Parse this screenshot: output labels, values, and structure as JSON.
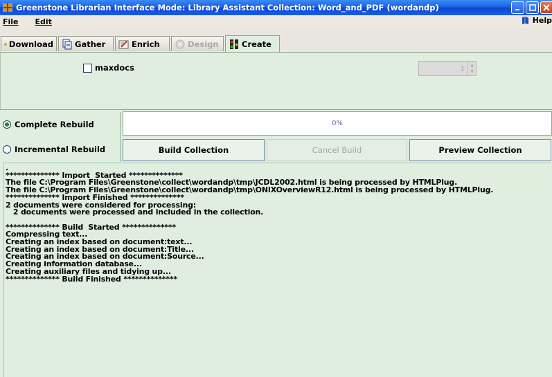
{
  "window": {
    "title": "Greenstone Librarian Interface  Mode: Library Assistant  Collection: Word_and_PDF (wordandp)"
  },
  "menu": {
    "file": "File",
    "edit": "Edit",
    "help": "Help"
  },
  "tabs": [
    {
      "label": "Download",
      "icon": "download-icon",
      "enabled": true
    },
    {
      "label": "Gather",
      "icon": "gather-icon",
      "enabled": true
    },
    {
      "label": "Enrich",
      "icon": "enrich-icon",
      "enabled": true
    },
    {
      "label": "Design",
      "icon": "design-icon",
      "enabled": false
    },
    {
      "label": "Create",
      "icon": "create-icon",
      "enabled": true,
      "active": true
    }
  ],
  "options": {
    "maxdocs_label": "maxdocs",
    "maxdocs_checked": false,
    "maxdocs_value": "1"
  },
  "build": {
    "complete_rebuild": "Complete Rebuild",
    "incremental_rebuild": "Incremental Rebuild",
    "selected": "complete",
    "progress_text": "0%",
    "progress_value": 0,
    "build_button": "Build Collection",
    "cancel_button": "Cancel Build",
    "preview_button": "Preview Collection"
  },
  "log": [
    ".",
    "************** Import  Started **************",
    "The file C:\\Program Files\\Greenstone\\collect\\wordandp\\tmp\\JCDL2002.html is being processed by HTMLPlug.",
    "The file C:\\Program Files\\Greenstone\\collect\\wordandp\\tmp\\ONIXOverviewR12.html is being processed by HTMLPlug.",
    "************** Import Finished **************",
    "2 documents were considered for processing:",
    "   2 documents were processed and included in the collection.",
    "",
    "************** Build  Started **************",
    "Compressing text...",
    "Creating an index based on document:text...",
    "Creating an index based on document:Title...",
    "Creating an index based on document:Source...",
    "Creating information database...",
    "Creating auxiliary files and tidying up...",
    "************** Build Finished **************"
  ],
  "colors": {
    "titlebar": "#0a46d6",
    "panel": "#e0eee0",
    "radio_selected": "#2a7d2a"
  }
}
